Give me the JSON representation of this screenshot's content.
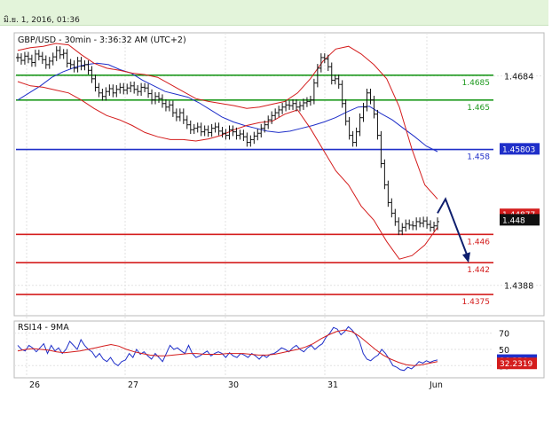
{
  "header": {
    "timestamp": "มิ.ย. 1, 2016, 01:36"
  },
  "chart_data": [
    {
      "type": "line",
      "panel": "price",
      "title": "GBP/USD - 30min - 3:36:32 AM (UTC+2)",
      "ylim": [
        1.4345,
        1.4745
      ],
      "x_categories": [
        "26",
        "27",
        "30",
        "31",
        "Jun"
      ],
      "y_ticks": [
        1.4684,
        1.4388
      ],
      "legend": "none",
      "grid": true,
      "levels": [
        {
          "value": 1.4685,
          "label": "1.4685",
          "color": "#1f9a1f",
          "role": "resistance"
        },
        {
          "value": 1.465,
          "label": "1.465",
          "color": "#1f9a1f",
          "role": "resistance"
        },
        {
          "value": 1.458,
          "label": "1.458",
          "color": "#1f2fc9",
          "role": "pivot"
        },
        {
          "value": 1.446,
          "label": "1.446",
          "color": "#d41d1d",
          "role": "support"
        },
        {
          "value": 1.442,
          "label": "1.442",
          "color": "#d41d1d",
          "role": "support"
        },
        {
          "value": 1.4375,
          "label": "1.4375",
          "color": "#d41d1d",
          "role": "support"
        }
      ],
      "price_badges": [
        {
          "value": 1.45803,
          "label": "1.45803",
          "bg": "#1f2fc9",
          "fg": "#ffffff"
        },
        {
          "value": 1.44877,
          "label": "1.44877",
          "bg": "#d41d1d",
          "fg": "#ffffff"
        },
        {
          "value": 1.448,
          "label": "1.448",
          "bg": "#111111",
          "fg": "#ffffff"
        }
      ],
      "series": [
        {
          "name": "price",
          "color": "#111111",
          "style": "ohlc-bars",
          "values": [
            1.471,
            1.4706,
            1.4712,
            1.4708,
            1.4703,
            1.4715,
            1.4712,
            1.4707,
            1.47,
            1.4705,
            1.4711,
            1.472,
            1.4714,
            1.4716,
            1.4702,
            1.47,
            1.4695,
            1.4705,
            1.4698,
            1.47,
            1.4692,
            1.468,
            1.4668,
            1.466,
            1.4655,
            1.4662,
            1.4666,
            1.466,
            1.4665,
            1.4668,
            1.4664,
            1.4667,
            1.467,
            1.4665,
            1.4662,
            1.4668,
            1.4667,
            1.4659,
            1.465,
            1.4655,
            1.4652,
            1.4645,
            1.464,
            1.4643,
            1.4632,
            1.4626,
            1.4632,
            1.4622,
            1.4615,
            1.4608,
            1.461,
            1.4612,
            1.4605,
            1.4608,
            1.4604,
            1.461,
            1.4612,
            1.4606,
            1.4603,
            1.46,
            1.4608,
            1.4605,
            1.46,
            1.4602,
            1.4598,
            1.459,
            1.4594,
            1.4599,
            1.4603,
            1.461,
            1.4615,
            1.4622,
            1.4628,
            1.4632,
            1.4636,
            1.464,
            1.4643,
            1.4642,
            1.4645,
            1.464,
            1.4642,
            1.4646,
            1.4648,
            1.465,
            1.4674,
            1.4695,
            1.471,
            1.4708,
            1.4697,
            1.4678,
            1.468,
            1.4672,
            1.4645,
            1.462,
            1.46,
            1.459,
            1.4605,
            1.4625,
            1.464,
            1.466,
            1.465,
            1.463,
            1.46,
            1.456,
            1.453,
            1.4505,
            1.449,
            1.4478,
            1.4465,
            1.447,
            1.4475,
            1.4473,
            1.4472,
            1.4478,
            1.4476,
            1.4479,
            1.4474,
            1.447,
            1.4472,
            1.4478
          ]
        },
        {
          "name": "MA",
          "color": "#1f2fc9",
          "style": "line",
          "values": [
            1.465,
            1.466,
            1.467,
            1.4682,
            1.469,
            1.4696,
            1.47,
            1.4702,
            1.47,
            1.4693,
            1.4688,
            1.4678,
            1.467,
            1.4662,
            1.4658,
            1.4654,
            1.4646,
            1.4636,
            1.4626,
            1.4619,
            1.4614,
            1.461,
            1.4606,
            1.4604,
            1.4606,
            1.461,
            1.4614,
            1.4619,
            1.4625,
            1.4633,
            1.464,
            1.4641,
            1.4631,
            1.4622,
            1.461,
            1.4598,
            1.4585,
            1.4577
          ]
        },
        {
          "name": "upper band",
          "color": "#d41d1d",
          "style": "line",
          "values": [
            1.472,
            1.4724,
            1.4726,
            1.473,
            1.4728,
            1.4714,
            1.4702,
            1.4695,
            1.4692,
            1.4688,
            1.4686,
            1.4682,
            1.4672,
            1.4662,
            1.4652,
            1.4648,
            1.4645,
            1.4642,
            1.4638,
            1.464,
            1.4644,
            1.4648,
            1.466,
            1.468,
            1.4705,
            1.4722,
            1.4726,
            1.4715,
            1.47,
            1.468,
            1.464,
            1.458,
            1.453,
            1.451
          ]
        },
        {
          "name": "lower band",
          "color": "#d41d1d",
          "style": "line",
          "values": [
            1.4676,
            1.467,
            1.4668,
            1.4664,
            1.466,
            1.465,
            1.4638,
            1.4628,
            1.4622,
            1.4614,
            1.4604,
            1.4598,
            1.4594,
            1.4594,
            1.4592,
            1.4595,
            1.46,
            1.4608,
            1.4614,
            1.4618,
            1.462,
            1.463,
            1.4636,
            1.461,
            1.458,
            1.455,
            1.453,
            1.45,
            1.448,
            1.445,
            1.4425,
            1.443,
            1.4445,
            1.447
          ]
        }
      ],
      "projection": {
        "from": 1.449,
        "peak": 1.451,
        "to": 1.4425,
        "color": "#0f1f6e"
      }
    },
    {
      "type": "line",
      "panel": "indicator",
      "title": "RSI14 - 9MA",
      "ylim": [
        15,
        85
      ],
      "y_ticks": [
        70,
        50,
        30
      ],
      "legend": "none",
      "price_badges": [
        {
          "value": 36.256,
          "label": "36.256",
          "bg": "#1f2fc9",
          "fg": "#ffffff"
        },
        {
          "value": 32.2319,
          "label": "32.2319",
          "bg": "#d41d1d",
          "fg": "#ffffff"
        }
      ],
      "series": [
        {
          "name": "RSI14",
          "color": "#1f2fc9",
          "values": [
            55,
            50,
            48,
            55,
            52,
            47,
            52,
            57,
            45,
            55,
            48,
            52,
            45,
            50,
            60,
            55,
            50,
            62,
            55,
            50,
            47,
            40,
            45,
            38,
            35,
            40,
            33,
            30,
            35,
            37,
            45,
            40,
            50,
            44,
            47,
            42,
            38,
            45,
            40,
            35,
            45,
            55,
            50,
            52,
            48,
            45,
            55,
            45,
            40,
            42,
            45,
            48,
            42,
            45,
            47,
            45,
            40,
            46,
            42,
            40,
            45,
            43,
            40,
            45,
            42,
            38,
            43,
            40,
            44,
            45,
            48,
            52,
            50,
            47,
            52,
            55,
            50,
            47,
            52,
            55,
            50,
            54,
            57,
            65,
            70,
            77,
            75,
            68,
            72,
            78,
            74,
            68,
            60,
            45,
            38,
            36,
            40,
            43,
            50,
            45,
            38,
            30,
            28,
            25,
            24,
            28,
            26,
            30,
            35,
            33,
            36,
            34,
            36,
            37
          ]
        },
        {
          "name": "9MA",
          "color": "#d41d1d",
          "values": [
            48,
            50,
            51,
            50,
            49,
            47,
            46,
            47,
            48,
            50,
            52,
            54,
            56,
            54,
            50,
            47,
            45,
            43,
            42,
            42,
            43,
            44,
            45,
            45,
            44,
            44,
            44,
            45,
            45,
            45,
            44,
            43,
            43,
            44,
            46,
            48,
            50,
            53,
            57,
            63,
            68,
            72,
            74,
            72,
            66,
            58,
            50,
            43,
            38,
            34,
            31,
            30,
            31,
            33,
            35
          ]
        }
      ]
    }
  ]
}
